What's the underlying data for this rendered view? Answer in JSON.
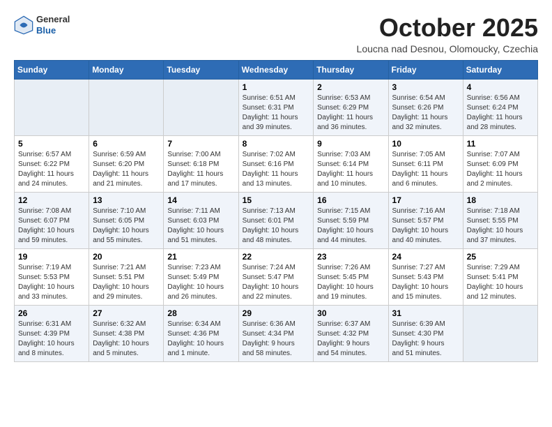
{
  "header": {
    "logo_general": "General",
    "logo_blue": "Blue",
    "month_title": "October 2025",
    "subtitle": "Loucna nad Desnou, Olomoucky, Czechia"
  },
  "calendar": {
    "days_of_week": [
      "Sunday",
      "Monday",
      "Tuesday",
      "Wednesday",
      "Thursday",
      "Friday",
      "Saturday"
    ],
    "weeks": [
      [
        {
          "day": "",
          "info": ""
        },
        {
          "day": "",
          "info": ""
        },
        {
          "day": "",
          "info": ""
        },
        {
          "day": "1",
          "info": "Sunrise: 6:51 AM\nSunset: 6:31 PM\nDaylight: 11 hours\nand 39 minutes."
        },
        {
          "day": "2",
          "info": "Sunrise: 6:53 AM\nSunset: 6:29 PM\nDaylight: 11 hours\nand 36 minutes."
        },
        {
          "day": "3",
          "info": "Sunrise: 6:54 AM\nSunset: 6:26 PM\nDaylight: 11 hours\nand 32 minutes."
        },
        {
          "day": "4",
          "info": "Sunrise: 6:56 AM\nSunset: 6:24 PM\nDaylight: 11 hours\nand 28 minutes."
        }
      ],
      [
        {
          "day": "5",
          "info": "Sunrise: 6:57 AM\nSunset: 6:22 PM\nDaylight: 11 hours\nand 24 minutes."
        },
        {
          "day": "6",
          "info": "Sunrise: 6:59 AM\nSunset: 6:20 PM\nDaylight: 11 hours\nand 21 minutes."
        },
        {
          "day": "7",
          "info": "Sunrise: 7:00 AM\nSunset: 6:18 PM\nDaylight: 11 hours\nand 17 minutes."
        },
        {
          "day": "8",
          "info": "Sunrise: 7:02 AM\nSunset: 6:16 PM\nDaylight: 11 hours\nand 13 minutes."
        },
        {
          "day": "9",
          "info": "Sunrise: 7:03 AM\nSunset: 6:14 PM\nDaylight: 11 hours\nand 10 minutes."
        },
        {
          "day": "10",
          "info": "Sunrise: 7:05 AM\nSunset: 6:11 PM\nDaylight: 11 hours\nand 6 minutes."
        },
        {
          "day": "11",
          "info": "Sunrise: 7:07 AM\nSunset: 6:09 PM\nDaylight: 11 hours\nand 2 minutes."
        }
      ],
      [
        {
          "day": "12",
          "info": "Sunrise: 7:08 AM\nSunset: 6:07 PM\nDaylight: 10 hours\nand 59 minutes."
        },
        {
          "day": "13",
          "info": "Sunrise: 7:10 AM\nSunset: 6:05 PM\nDaylight: 10 hours\nand 55 minutes."
        },
        {
          "day": "14",
          "info": "Sunrise: 7:11 AM\nSunset: 6:03 PM\nDaylight: 10 hours\nand 51 minutes."
        },
        {
          "day": "15",
          "info": "Sunrise: 7:13 AM\nSunset: 6:01 PM\nDaylight: 10 hours\nand 48 minutes."
        },
        {
          "day": "16",
          "info": "Sunrise: 7:15 AM\nSunset: 5:59 PM\nDaylight: 10 hours\nand 44 minutes."
        },
        {
          "day": "17",
          "info": "Sunrise: 7:16 AM\nSunset: 5:57 PM\nDaylight: 10 hours\nand 40 minutes."
        },
        {
          "day": "18",
          "info": "Sunrise: 7:18 AM\nSunset: 5:55 PM\nDaylight: 10 hours\nand 37 minutes."
        }
      ],
      [
        {
          "day": "19",
          "info": "Sunrise: 7:19 AM\nSunset: 5:53 PM\nDaylight: 10 hours\nand 33 minutes."
        },
        {
          "day": "20",
          "info": "Sunrise: 7:21 AM\nSunset: 5:51 PM\nDaylight: 10 hours\nand 29 minutes."
        },
        {
          "day": "21",
          "info": "Sunrise: 7:23 AM\nSunset: 5:49 PM\nDaylight: 10 hours\nand 26 minutes."
        },
        {
          "day": "22",
          "info": "Sunrise: 7:24 AM\nSunset: 5:47 PM\nDaylight: 10 hours\nand 22 minutes."
        },
        {
          "day": "23",
          "info": "Sunrise: 7:26 AM\nSunset: 5:45 PM\nDaylight: 10 hours\nand 19 minutes."
        },
        {
          "day": "24",
          "info": "Sunrise: 7:27 AM\nSunset: 5:43 PM\nDaylight: 10 hours\nand 15 minutes."
        },
        {
          "day": "25",
          "info": "Sunrise: 7:29 AM\nSunset: 5:41 PM\nDaylight: 10 hours\nand 12 minutes."
        }
      ],
      [
        {
          "day": "26",
          "info": "Sunrise: 6:31 AM\nSunset: 4:39 PM\nDaylight: 10 hours\nand 8 minutes."
        },
        {
          "day": "27",
          "info": "Sunrise: 6:32 AM\nSunset: 4:38 PM\nDaylight: 10 hours\nand 5 minutes."
        },
        {
          "day": "28",
          "info": "Sunrise: 6:34 AM\nSunset: 4:36 PM\nDaylight: 10 hours\nand 1 minute."
        },
        {
          "day": "29",
          "info": "Sunrise: 6:36 AM\nSunset: 4:34 PM\nDaylight: 9 hours\nand 58 minutes."
        },
        {
          "day": "30",
          "info": "Sunrise: 6:37 AM\nSunset: 4:32 PM\nDaylight: 9 hours\nand 54 minutes."
        },
        {
          "day": "31",
          "info": "Sunrise: 6:39 AM\nSunset: 4:30 PM\nDaylight: 9 hours\nand 51 minutes."
        },
        {
          "day": "",
          "info": ""
        }
      ]
    ]
  }
}
